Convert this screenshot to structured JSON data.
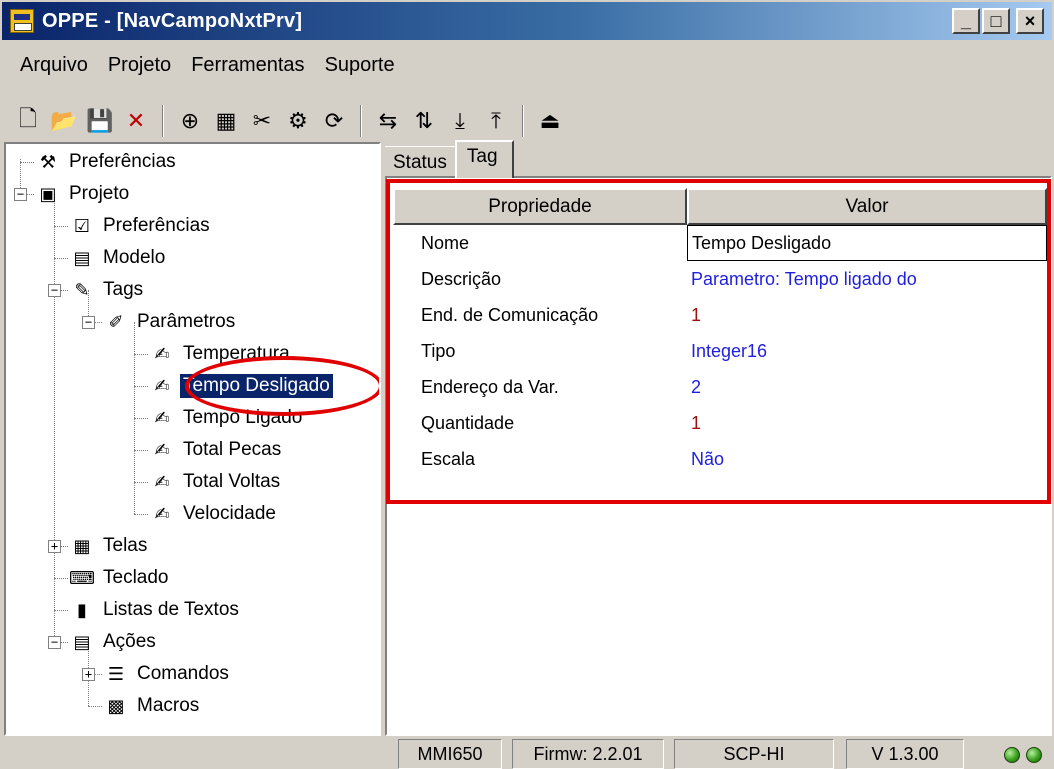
{
  "window": {
    "title": "OPPE - [NavCampoNxtPrv]",
    "buttons": {
      "minimize": "_",
      "maximize": "□",
      "close": "×"
    }
  },
  "menu": [
    {
      "label": "Arquivo"
    },
    {
      "label": "Projeto"
    },
    {
      "label": "Ferramentas"
    },
    {
      "label": "Suporte"
    }
  ],
  "toolbar": {
    "icons": [
      {
        "name": "new-file-icon",
        "glyph": "🗋"
      },
      {
        "name": "open-folder-icon",
        "glyph": "📂"
      },
      {
        "name": "save-icon",
        "glyph": "💾"
      },
      {
        "name": "delete-icon",
        "glyph": "✕"
      },
      {
        "name": "tree-tool-icon",
        "glyph": "⊕"
      },
      {
        "name": "screen-tool-icon",
        "glyph": "▦"
      },
      {
        "name": "tags-tool-icon",
        "glyph": "✂"
      },
      {
        "name": "params-tool-icon",
        "glyph": "⚙"
      },
      {
        "name": "refresh-icon",
        "glyph": "⟳"
      },
      {
        "name": "connect-icon",
        "glyph": "⇆"
      },
      {
        "name": "transfer-icon",
        "glyph": "⇅"
      },
      {
        "name": "download-icon",
        "glyph": "⤓"
      },
      {
        "name": "upload-icon",
        "glyph": "⤒"
      },
      {
        "name": "exit-icon",
        "glyph": "⏏"
      }
    ],
    "accent": "#c00000"
  },
  "tree": {
    "items": [
      {
        "label": "Preferências",
        "icon": "tools-icon",
        "glyph": "⚒"
      },
      {
        "label": "Projeto",
        "icon": "project-icon",
        "glyph": "▣"
      },
      {
        "label": "Preferências",
        "icon": "preferences-icon",
        "glyph": "☑"
      },
      {
        "label": "Modelo",
        "icon": "model-icon",
        "glyph": "▤"
      },
      {
        "label": "Tags",
        "icon": "tags-icon",
        "glyph": "✎"
      },
      {
        "label": "Parâmetros",
        "icon": "parameters-icon",
        "glyph": "✐"
      },
      {
        "label": "Temperatura",
        "icon": "tag-icon",
        "glyph": "✍"
      },
      {
        "label": "Tempo Desligado",
        "icon": "tag-icon",
        "glyph": "✍"
      },
      {
        "label": "Tempo Ligado",
        "icon": "tag-icon",
        "glyph": "✍"
      },
      {
        "label": "Total Pecas",
        "icon": "tag-icon",
        "glyph": "✍"
      },
      {
        "label": "Total Voltas",
        "icon": "tag-icon",
        "glyph": "✍"
      },
      {
        "label": "Velocidade",
        "icon": "tag-icon",
        "glyph": "✍"
      },
      {
        "label": "Telas",
        "icon": "screens-icon",
        "glyph": "▦"
      },
      {
        "label": "Teclado",
        "icon": "keyboard-icon",
        "glyph": "⌨"
      },
      {
        "label": "Listas de Textos",
        "icon": "text-lists-icon",
        "glyph": "▮"
      },
      {
        "label": "Ações",
        "icon": "actions-icon",
        "glyph": "▤"
      },
      {
        "label": "Comandos",
        "icon": "commands-icon",
        "glyph": "☰"
      },
      {
        "label": "Macros",
        "icon": "macros-icon",
        "glyph": "▩"
      }
    ]
  },
  "tabs": [
    {
      "label": "Status",
      "active": false
    },
    {
      "label": "Tag",
      "active": true
    }
  ],
  "grid": {
    "header": {
      "property": "Propriedade",
      "value": "Valor"
    },
    "rows": [
      {
        "property": "Nome",
        "value": "Tempo Desligado",
        "color": "#000000"
      },
      {
        "property": "Descrição",
        "value": "Parametro: Tempo ligado do",
        "color": "#2020e0"
      },
      {
        "property": "End. de Comunicação",
        "value": "1",
        "color": "#a01010"
      },
      {
        "property": "Tipo",
        "value": "Integer16",
        "color": "#2020e0"
      },
      {
        "property": "Endereço da Var.",
        "value": "2",
        "color": "#2020e0"
      },
      {
        "property": "Quantidade",
        "value": "1",
        "color": "#a01010"
      },
      {
        "property": "Escala",
        "value": "Não",
        "color": "#2020e0"
      }
    ]
  },
  "statusbar": {
    "fields": [
      "MMI650",
      "Firmw: 2.2.01",
      "SCP-HI",
      "V 1.3.00"
    ],
    "led_color": "#3aa020"
  },
  "highlight_color": "#e00000"
}
